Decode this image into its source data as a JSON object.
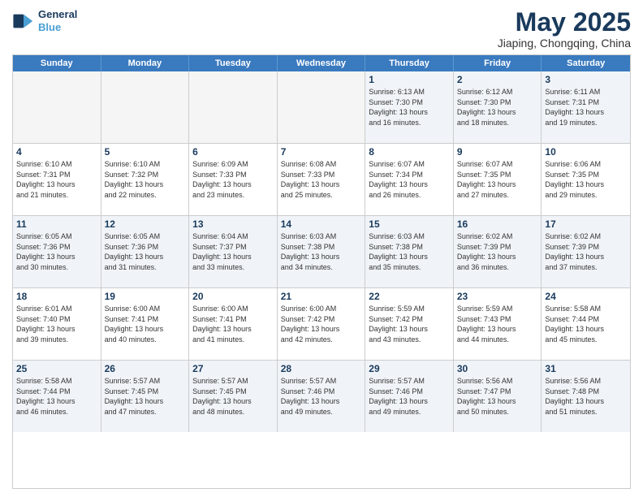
{
  "logo": {
    "line1": "General",
    "line2": "Blue"
  },
  "title": "May 2025",
  "subtitle": "Jiaping, Chongqing, China",
  "days_of_week": [
    "Sunday",
    "Monday",
    "Tuesday",
    "Wednesday",
    "Thursday",
    "Friday",
    "Saturday"
  ],
  "weeks": [
    [
      {
        "day": "",
        "info": "",
        "empty": true
      },
      {
        "day": "",
        "info": "",
        "empty": true
      },
      {
        "day": "",
        "info": "",
        "empty": true
      },
      {
        "day": "",
        "info": "",
        "empty": true
      },
      {
        "day": "1",
        "info": "Sunrise: 6:13 AM\nSunset: 7:30 PM\nDaylight: 13 hours\nand 16 minutes."
      },
      {
        "day": "2",
        "info": "Sunrise: 6:12 AM\nSunset: 7:30 PM\nDaylight: 13 hours\nand 18 minutes."
      },
      {
        "day": "3",
        "info": "Sunrise: 6:11 AM\nSunset: 7:31 PM\nDaylight: 13 hours\nand 19 minutes."
      }
    ],
    [
      {
        "day": "4",
        "info": "Sunrise: 6:10 AM\nSunset: 7:31 PM\nDaylight: 13 hours\nand 21 minutes."
      },
      {
        "day": "5",
        "info": "Sunrise: 6:10 AM\nSunset: 7:32 PM\nDaylight: 13 hours\nand 22 minutes."
      },
      {
        "day": "6",
        "info": "Sunrise: 6:09 AM\nSunset: 7:33 PM\nDaylight: 13 hours\nand 23 minutes."
      },
      {
        "day": "7",
        "info": "Sunrise: 6:08 AM\nSunset: 7:33 PM\nDaylight: 13 hours\nand 25 minutes."
      },
      {
        "day": "8",
        "info": "Sunrise: 6:07 AM\nSunset: 7:34 PM\nDaylight: 13 hours\nand 26 minutes."
      },
      {
        "day": "9",
        "info": "Sunrise: 6:07 AM\nSunset: 7:35 PM\nDaylight: 13 hours\nand 27 minutes."
      },
      {
        "day": "10",
        "info": "Sunrise: 6:06 AM\nSunset: 7:35 PM\nDaylight: 13 hours\nand 29 minutes."
      }
    ],
    [
      {
        "day": "11",
        "info": "Sunrise: 6:05 AM\nSunset: 7:36 PM\nDaylight: 13 hours\nand 30 minutes."
      },
      {
        "day": "12",
        "info": "Sunrise: 6:05 AM\nSunset: 7:36 PM\nDaylight: 13 hours\nand 31 minutes."
      },
      {
        "day": "13",
        "info": "Sunrise: 6:04 AM\nSunset: 7:37 PM\nDaylight: 13 hours\nand 33 minutes."
      },
      {
        "day": "14",
        "info": "Sunrise: 6:03 AM\nSunset: 7:38 PM\nDaylight: 13 hours\nand 34 minutes."
      },
      {
        "day": "15",
        "info": "Sunrise: 6:03 AM\nSunset: 7:38 PM\nDaylight: 13 hours\nand 35 minutes."
      },
      {
        "day": "16",
        "info": "Sunrise: 6:02 AM\nSunset: 7:39 PM\nDaylight: 13 hours\nand 36 minutes."
      },
      {
        "day": "17",
        "info": "Sunrise: 6:02 AM\nSunset: 7:39 PM\nDaylight: 13 hours\nand 37 minutes."
      }
    ],
    [
      {
        "day": "18",
        "info": "Sunrise: 6:01 AM\nSunset: 7:40 PM\nDaylight: 13 hours\nand 39 minutes."
      },
      {
        "day": "19",
        "info": "Sunrise: 6:00 AM\nSunset: 7:41 PM\nDaylight: 13 hours\nand 40 minutes."
      },
      {
        "day": "20",
        "info": "Sunrise: 6:00 AM\nSunset: 7:41 PM\nDaylight: 13 hours\nand 41 minutes."
      },
      {
        "day": "21",
        "info": "Sunrise: 6:00 AM\nSunset: 7:42 PM\nDaylight: 13 hours\nand 42 minutes."
      },
      {
        "day": "22",
        "info": "Sunrise: 5:59 AM\nSunset: 7:42 PM\nDaylight: 13 hours\nand 43 minutes."
      },
      {
        "day": "23",
        "info": "Sunrise: 5:59 AM\nSunset: 7:43 PM\nDaylight: 13 hours\nand 44 minutes."
      },
      {
        "day": "24",
        "info": "Sunrise: 5:58 AM\nSunset: 7:44 PM\nDaylight: 13 hours\nand 45 minutes."
      }
    ],
    [
      {
        "day": "25",
        "info": "Sunrise: 5:58 AM\nSunset: 7:44 PM\nDaylight: 13 hours\nand 46 minutes."
      },
      {
        "day": "26",
        "info": "Sunrise: 5:57 AM\nSunset: 7:45 PM\nDaylight: 13 hours\nand 47 minutes."
      },
      {
        "day": "27",
        "info": "Sunrise: 5:57 AM\nSunset: 7:45 PM\nDaylight: 13 hours\nand 48 minutes."
      },
      {
        "day": "28",
        "info": "Sunrise: 5:57 AM\nSunset: 7:46 PM\nDaylight: 13 hours\nand 49 minutes."
      },
      {
        "day": "29",
        "info": "Sunrise: 5:57 AM\nSunset: 7:46 PM\nDaylight: 13 hours\nand 49 minutes."
      },
      {
        "day": "30",
        "info": "Sunrise: 5:56 AM\nSunset: 7:47 PM\nDaylight: 13 hours\nand 50 minutes."
      },
      {
        "day": "31",
        "info": "Sunrise: 5:56 AM\nSunset: 7:48 PM\nDaylight: 13 hours\nand 51 minutes."
      }
    ]
  ]
}
